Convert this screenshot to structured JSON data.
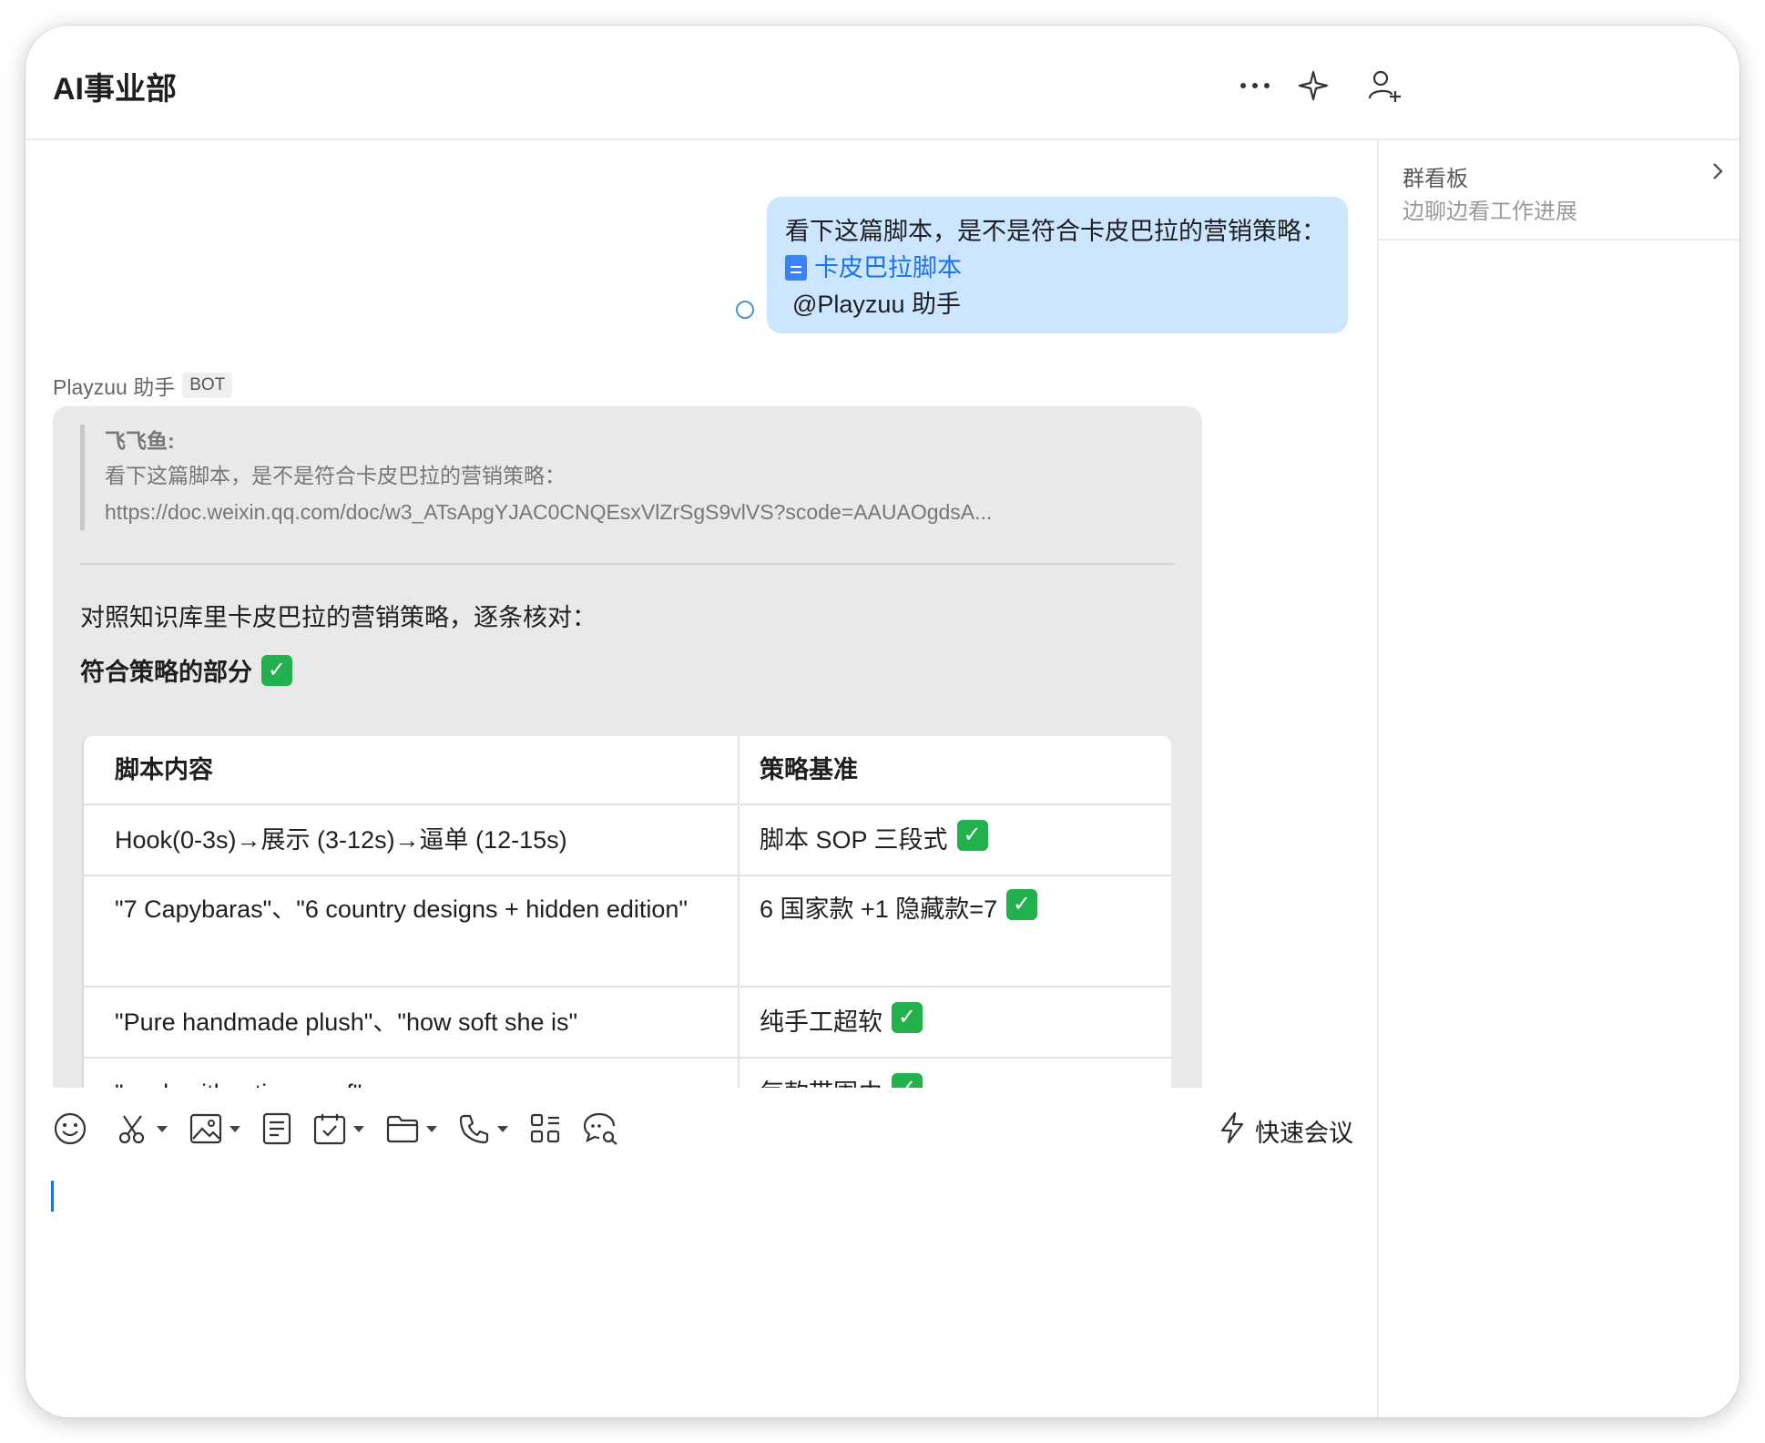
{
  "header": {
    "title": "AI事业部",
    "icons": [
      "more-icon",
      "sparkle-icon",
      "add-member-icon"
    ]
  },
  "board": {
    "title": "群看板",
    "subtitle": "边聊边看工作进展"
  },
  "outgoing_message": {
    "text": "看下这篇脚本，是不是符合卡皮巴拉的营销策略：",
    "doc_link": "卡皮巴拉脚本",
    "mention": "@Playzuu 助手"
  },
  "incoming_message": {
    "sender": "Playzuu 助手",
    "badge": "BOT",
    "quote": {
      "author": "飞飞鱼:",
      "line1": "看下这篇脚本，是不是符合卡皮巴拉的营销策略：",
      "line2": "https://doc.weixin.qq.com/doc/w3_ATsApgYJAC0CNQEsxVlZrSgS9vlVS?scode=AAUAOgdsA..."
    },
    "intro": "对照知识库里卡皮巴拉的营销策略，逐条核对：",
    "subheading": "符合策略的部分",
    "table": {
      "headers": [
        "脚本内容",
        "策略基准"
      ],
      "rows": [
        {
          "content": "Hook(0-3s)→展示 (3-12s)→逼单 (12-15s)",
          "basis": "脚本 SOP 三段式"
        },
        {
          "content": "\"7 Capybaras\"、\"6 country designs + hidden edition\"",
          "basis": "6 国家款 +1 隐藏款=7"
        },
        {
          "content": "\"Pure handmade plush\"、\"how soft she is\"",
          "basis": "纯手工超软"
        },
        {
          "content": "\"each with a tiny scarf\"",
          "basis": "每款带围巾"
        }
      ]
    },
    "check_glyph": "✓"
  },
  "composer": {
    "quick_meeting": "快速会议",
    "tools": [
      "emoji-icon",
      "screenshot-icon",
      "image-icon",
      "document-icon",
      "schedule-icon",
      "folder-icon",
      "phone-icon",
      "apps-icon",
      "chat-search-icon"
    ]
  },
  "colors": {
    "outgoing_bubble": "#cce6ff",
    "incoming_bubble": "#e9e9e9",
    "link": "#1a73e8",
    "check": "#22b14c"
  }
}
